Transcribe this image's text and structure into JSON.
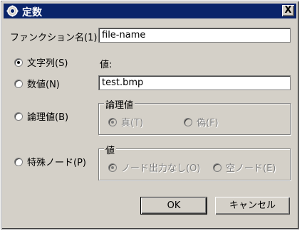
{
  "window": {
    "title": "定数",
    "close_label": "X"
  },
  "name_field": {
    "label": "ファンクション名(1):",
    "value": "file-name"
  },
  "value_label": "値:",
  "value_field": {
    "value": "test.bmp"
  },
  "type_options": [
    {
      "label": "文字列(S)",
      "selected": true
    },
    {
      "label": "数値(N)",
      "selected": false
    },
    {
      "label": "論理値(B)",
      "selected": false
    },
    {
      "label": "特殊ノード(P)",
      "selected": false
    }
  ],
  "boolean_group": {
    "title": "論理値",
    "options": [
      {
        "label": "真(T)",
        "selected": true
      },
      {
        "label": "偽(F)",
        "selected": false
      }
    ]
  },
  "special_group": {
    "title": "値",
    "options": [
      {
        "label": "ノード出力なし(O)",
        "selected": true
      },
      {
        "label": "空ノード(E)",
        "selected": false
      }
    ]
  },
  "buttons": {
    "ok": "OK",
    "cancel": "キャンセル"
  }
}
